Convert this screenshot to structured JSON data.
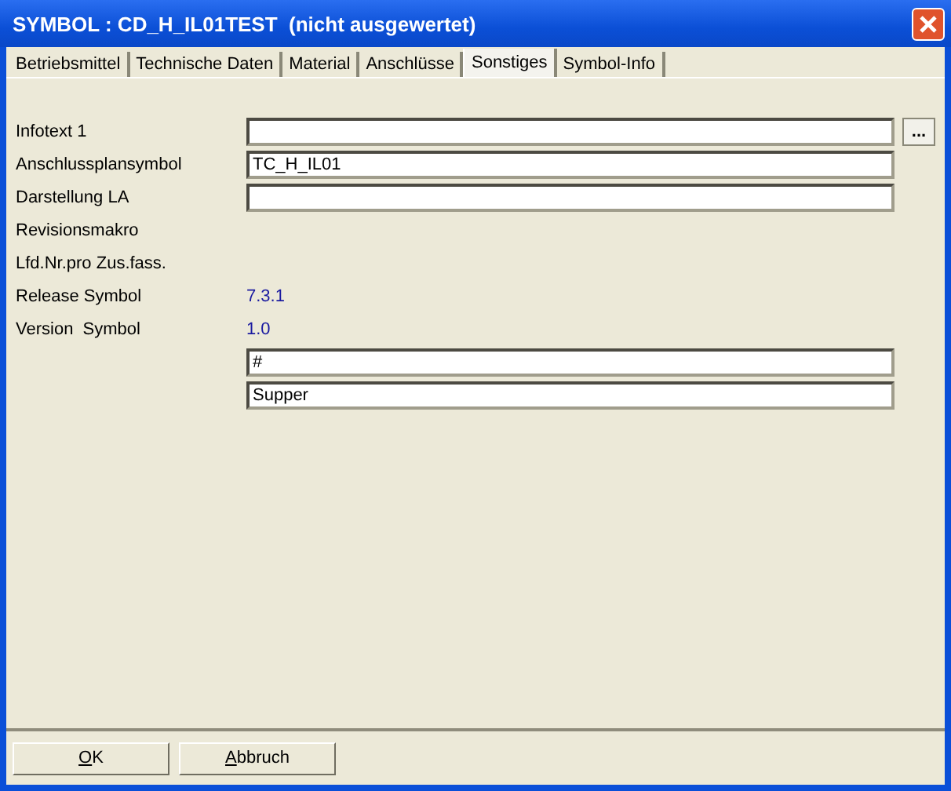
{
  "window": {
    "title": "SYMBOL : CD_H_IL01TEST  (nicht ausgewertet)"
  },
  "tabs": [
    {
      "label": "Betriebsmittel",
      "selected": false
    },
    {
      "label": "Technische Daten",
      "selected": false
    },
    {
      "label": "Material",
      "selected": false
    },
    {
      "label": "Anschlüsse",
      "selected": false
    },
    {
      "label": "Sonstiges",
      "selected": true
    },
    {
      "label": "Symbol-Info",
      "selected": false
    }
  ],
  "rows": [
    {
      "label": "Infotext 1",
      "kind": "field",
      "value": "",
      "browse": "..."
    },
    {
      "label": "Anschlussplansymbol",
      "kind": "field",
      "value": "TC_H_IL01"
    },
    {
      "label": "Darstellung LA",
      "kind": "field",
      "value": ""
    },
    {
      "label": "Revisionsmakro",
      "kind": "none"
    },
    {
      "label": "Lfd.Nr.pro Zus.fass.",
      "kind": "none"
    },
    {
      "label": "Release Symbol",
      "kind": "text",
      "value": "7.3.1"
    },
    {
      "label": "Version  Symbol",
      "kind": "text",
      "value": "1.0"
    },
    {
      "kind": "field",
      "value": "#"
    },
    {
      "kind": "field",
      "value": "Supper"
    }
  ],
  "buttons": [
    "OK",
    "Abbruch"
  ]
}
